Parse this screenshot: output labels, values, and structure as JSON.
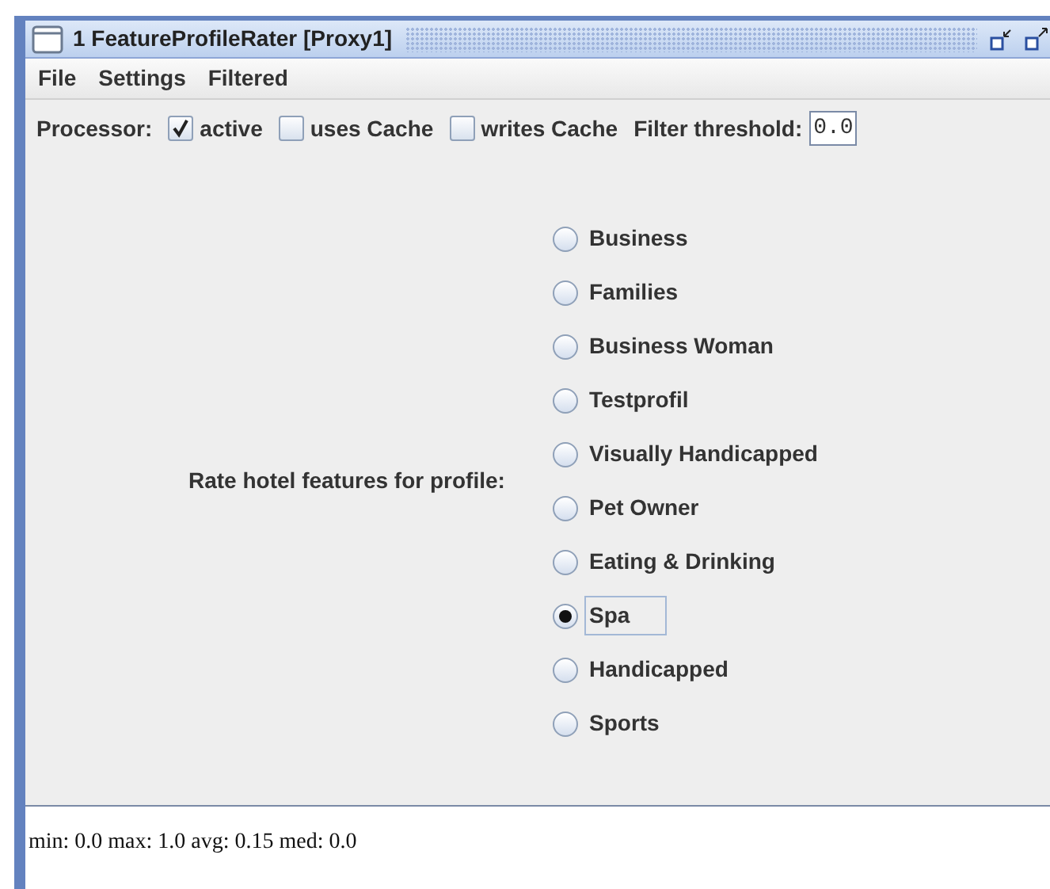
{
  "window": {
    "title": "1 FeatureProfileRater [Proxy1]"
  },
  "menu": [
    "File",
    "Settings",
    "Filtered"
  ],
  "toolbar": {
    "label": "Processor:",
    "checkboxes": [
      {
        "label": "active",
        "checked": true
      },
      {
        "label": "uses Cache",
        "checked": false
      },
      {
        "label": "writes Cache",
        "checked": false
      }
    ],
    "threshold_label": "Filter threshold:",
    "threshold_value": "0.0"
  },
  "profile_label": "Rate hotel features for profile:",
  "profiles": [
    {
      "label": "Business",
      "selected": false,
      "focused": false
    },
    {
      "label": "Families",
      "selected": false,
      "focused": false
    },
    {
      "label": "Business Woman",
      "selected": false,
      "focused": false
    },
    {
      "label": "Testprofil",
      "selected": false,
      "focused": false
    },
    {
      "label": "Visually Handicapped",
      "selected": false,
      "focused": false
    },
    {
      "label": "Pet Owner",
      "selected": false,
      "focused": false
    },
    {
      "label": "Eating & Drinking",
      "selected": false,
      "focused": false
    },
    {
      "label": "Spa",
      "selected": true,
      "focused": true
    },
    {
      "label": "Handicapped",
      "selected": false,
      "focused": false
    },
    {
      "label": "Sports",
      "selected": false,
      "focused": false
    }
  ],
  "stats": "min: 0.0 max: 1.0 avg: 0.15 med: 0.0"
}
